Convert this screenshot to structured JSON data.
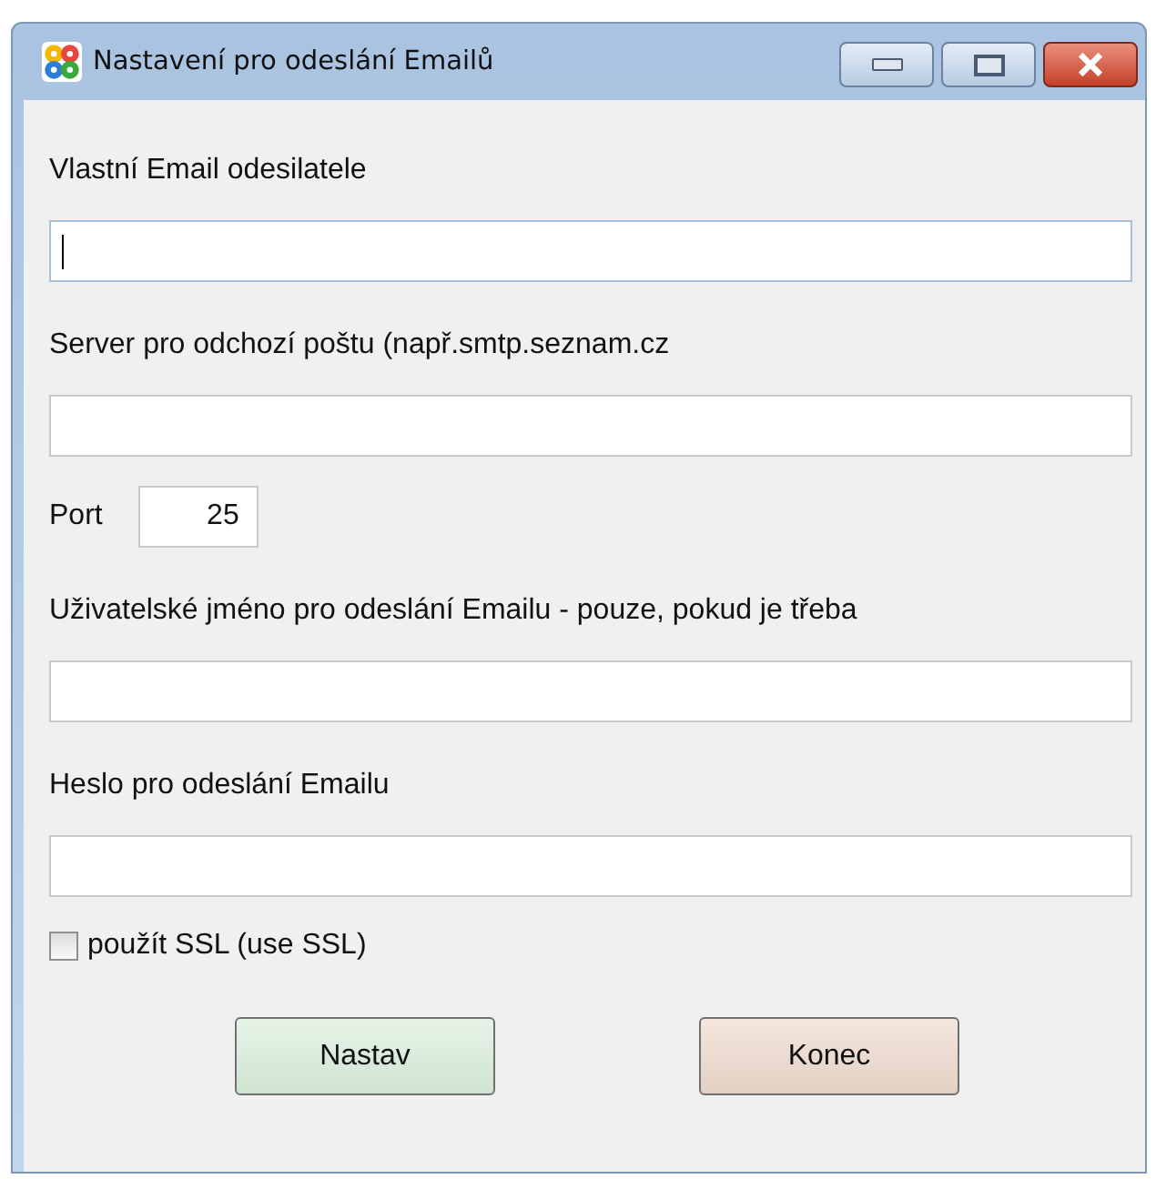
{
  "window": {
    "title": "Nastavení pro odeslání Emailů"
  },
  "fields": [
    {
      "kind": "text",
      "label": "Vlastní Email odesilatele",
      "focused": true
    },
    {
      "kind": "text",
      "label": "Server pro odchozí poštu (např.smtp.seznam.cz",
      "focused": false
    },
    {
      "kind": "port",
      "label": "Port",
      "value": "25",
      "focused": false
    },
    {
      "kind": "text",
      "label": "Uživatelské jméno pro odeslání Emailu - pouze, pokud je třeba",
      "focused": false
    },
    {
      "kind": "text",
      "label": "Heslo pro odeslání Emailu",
      "focused": false
    }
  ],
  "ssl": {
    "label": "použít SSL (use SSL)",
    "checked": false
  },
  "buttons": [
    {
      "label": "Nastav",
      "kind": "ok"
    },
    {
      "label": "Konec",
      "kind": "cancel"
    }
  ]
}
